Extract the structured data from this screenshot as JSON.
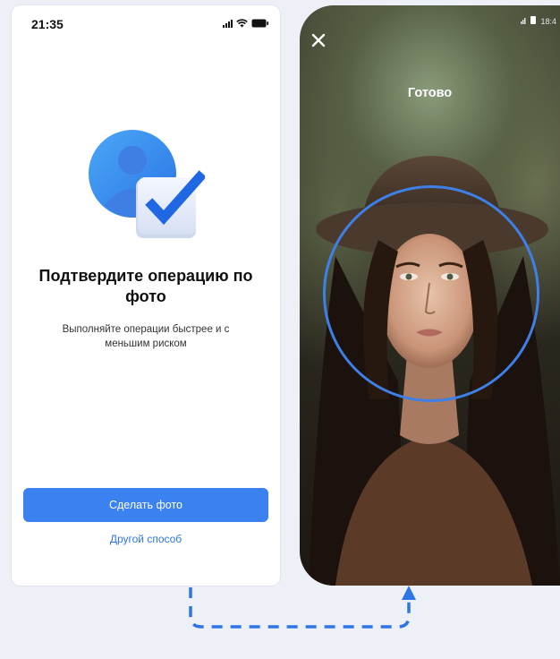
{
  "left_screen": {
    "status_time": "21:35",
    "title": "Подтвердите операцию по фото",
    "subtitle": "Выполняйте операции быстрее и с меньшим риском",
    "primary_button": "Сделать фото",
    "secondary_link": "Другой способ"
  },
  "right_screen": {
    "status_time": "18:4",
    "status_label": "Готово",
    "close_icon": "close-icon"
  },
  "colors": {
    "accent": "#3b82f0",
    "link": "#2f76e5",
    "frame": "#3f80e8",
    "page_bg": "#eef0f8"
  }
}
